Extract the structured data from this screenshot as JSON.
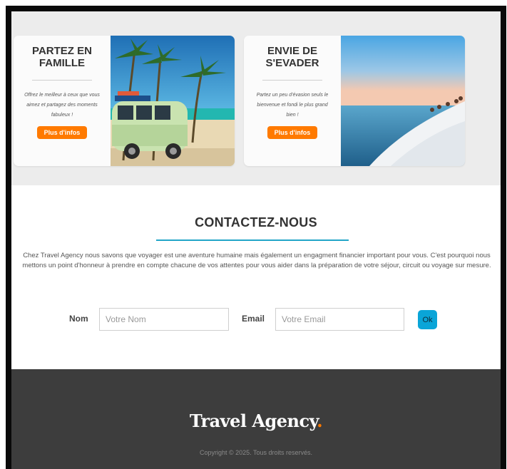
{
  "cards": [
    {
      "title": "PARTEZ EN FAMILLE",
      "description": "Offrez le meilleur à ceux que vous aimez et partagez des moments fabuleux !",
      "button_label": "Plus d'infos",
      "image": "van-beach-palms"
    },
    {
      "title": "ENVIE DE S'EVADER",
      "description": "Partez un peu d'évasion seuls le bienvenue et fondi le plus grand bien !",
      "button_label": "Plus d'infos",
      "image": "sea-cliff-people"
    }
  ],
  "contact": {
    "title": "CONTACTEZ-NOUS",
    "text": "Chez Travel Agency nous savons que voyager est une aventure humaine mais également un engagment financier important pour vous. C'est pourquoi nous mettons un point d'honneur à prendre en compte chacune de vos attentes pour vous aider dans la préparation de votre séjour, circuit ou voyage sur mesure.",
    "name_label": "Nom",
    "name_placeholder": "Votre Nom",
    "email_label": "Email",
    "email_placeholder": "Votre Email",
    "submit_label": "Ok"
  },
  "footer": {
    "brand": "Travel Agency",
    "brand_dot": ".",
    "copyright": "Copyright © 2025. Tous droits reservés."
  },
  "colors": {
    "accent_orange": "#ff7a00",
    "accent_blue": "#22a5c7",
    "footer_bg": "#3d3d3d"
  }
}
